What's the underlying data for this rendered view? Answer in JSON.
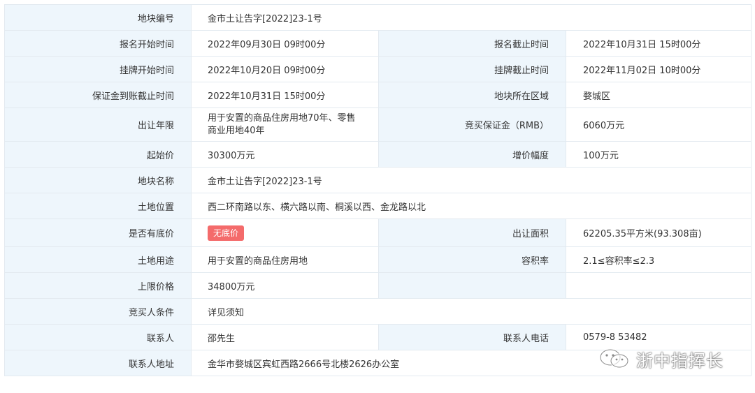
{
  "rows": {
    "plot_no": {
      "label": "地块编号",
      "value": "金市土让告字[2022]23-1号"
    },
    "reg_start": {
      "label": "报名开始时间",
      "value": "2022年09月30日 09时00分"
    },
    "reg_end": {
      "label": "报名截止时间",
      "value": "2022年10月31日 15时00分"
    },
    "list_start": {
      "label": "挂牌开始时间",
      "value": "2022年10月20日 09时00分"
    },
    "list_end": {
      "label": "挂牌截止时间",
      "value": "2022年11月02日 10时00分"
    },
    "deposit_deadline": {
      "label": "保证金到账截止时间",
      "value": "2022年10月31日 15时00分"
    },
    "district": {
      "label": "地块所在区域",
      "value": "婺城区"
    },
    "term": {
      "label": "出让年限",
      "value_line1": "用于安置的商品住房用地70年、零售",
      "value_line2": "商业用地40年"
    },
    "deposit": {
      "label": "竞买保证金（RMB）",
      "value": "6060万元"
    },
    "start_price": {
      "label": "起始价",
      "value": "30300万元"
    },
    "increment": {
      "label": "增价幅度",
      "value": "100万元"
    },
    "plot_name": {
      "label": "地块名称",
      "value": "金市土让告字[2022]23-1号"
    },
    "location": {
      "label": "土地位置",
      "value": "西二环南路以东、横六路以南、桐溪以西、金龙路以北"
    },
    "reserve": {
      "label": "是否有底价",
      "badge": "无底价"
    },
    "area": {
      "label": "出让面积",
      "value": "62205.35平方米(93.308亩)"
    },
    "usage": {
      "label": "土地用途",
      "value": "用于安置的商品住房用地"
    },
    "far": {
      "label": "容积率",
      "value": "2.1≤容积率≤2.3"
    },
    "cap_price": {
      "label": "上限价格",
      "value": "34800万元"
    },
    "conditions": {
      "label": "竞买人条件",
      "value": "详见须知"
    },
    "contact": {
      "label": "联系人",
      "value": "邵先生"
    },
    "phone": {
      "label": "联系人电话",
      "value": "0579-8 53482"
    },
    "address": {
      "label": "联系人地址",
      "value": "金华市婺城区宾虹西路2666号北楼2626办公室"
    }
  },
  "watermark": {
    "text": "浙中指挥长",
    "icon": "wechat-icon"
  },
  "colors": {
    "label_bg": "#eef6fc",
    "border": "#e3eaf0",
    "badge_bg": "#f46b6b"
  }
}
